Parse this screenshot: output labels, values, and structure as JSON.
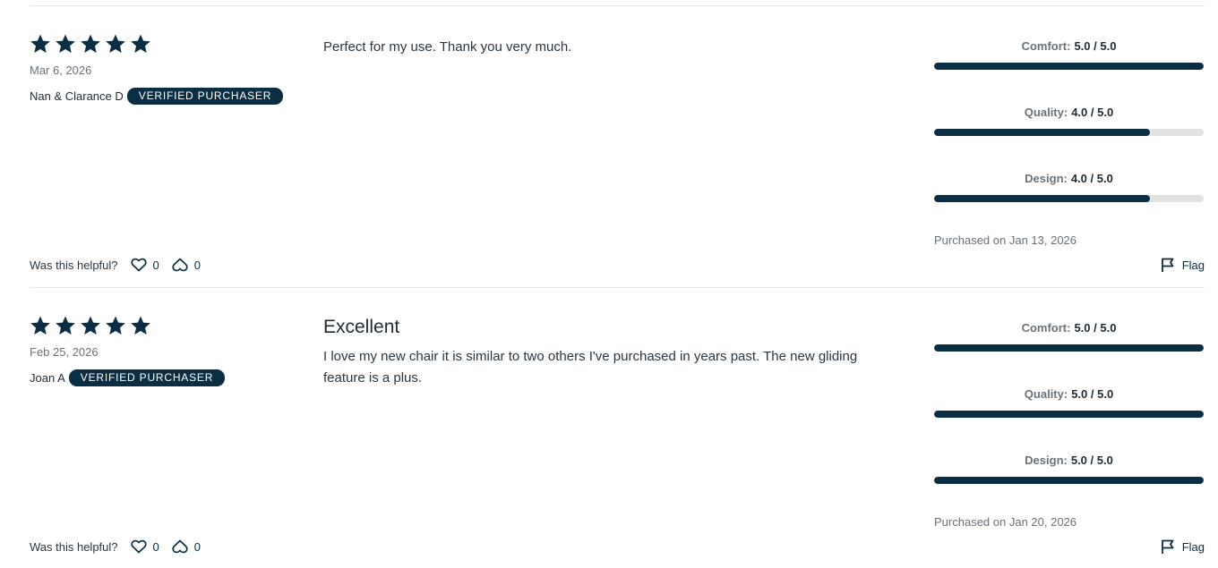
{
  "colors": {
    "accent": "#0b2e42",
    "bar_track": "#e2e2e2",
    "muted_text": "#6b7278"
  },
  "helpful_label": "Was this helpful?",
  "flag_label": "Flag",
  "reviews": [
    {
      "rating": 5,
      "date": "Mar 6, 2026",
      "author": "Nan & Clarance D",
      "badge": "VERIFIED PURCHASER",
      "title": "",
      "text": "Perfect for my use. Thank you very much.",
      "ratings": [
        {
          "name": "Comfort:",
          "value": "5.0 / 5.0",
          "fraction": 1.0
        },
        {
          "name": "Quality:",
          "value": "4.0 / 5.0",
          "fraction": 0.8
        },
        {
          "name": "Design:",
          "value": "4.0 / 5.0",
          "fraction": 0.8
        }
      ],
      "purchased": "Purchased on Jan 13, 2026",
      "likes": "0",
      "dislikes": "0"
    },
    {
      "rating": 5,
      "date": "Feb 25, 2026",
      "author": "Joan A",
      "badge": "VERIFIED PURCHASER",
      "title": "Excellent",
      "text": "I love my new chair it is similar to two others I've purchased in years past. The new gliding feature is a plus.",
      "ratings": [
        {
          "name": "Comfort:",
          "value": "5.0 / 5.0",
          "fraction": 1.0
        },
        {
          "name": "Quality:",
          "value": "5.0 / 5.0",
          "fraction": 1.0
        },
        {
          "name": "Design:",
          "value": "5.0 / 5.0",
          "fraction": 1.0
        }
      ],
      "purchased": "Purchased on Jan 20, 2026",
      "likes": "0",
      "dislikes": "0"
    }
  ]
}
